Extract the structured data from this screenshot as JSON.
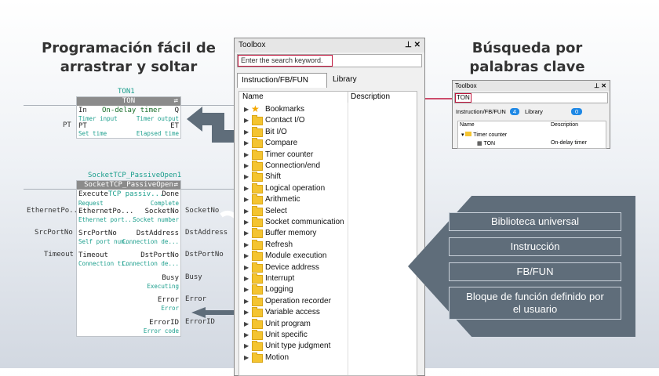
{
  "headings": {
    "drag": "Programación fácil de arrastrar y soltar",
    "search": "Búsqueda por palabras clave"
  },
  "ton_block": {
    "caption": "TON1",
    "title": "TON",
    "desc": "On-delay timer",
    "pins": {
      "in": "In",
      "in_sub": "Timer input",
      "q": "Q",
      "q_sub": "Timer output",
      "pt": "PT",
      "pt_sub": "Set time",
      "et": "ET",
      "et_sub": "Elapsed time"
    },
    "ext_pt": "PT"
  },
  "socket_block": {
    "caption": "SocketTCP_PassiveOpen1",
    "title": "SocketTCP_PassiveOpen",
    "left_pins": [
      {
        "label": "Execute",
        "sub": "Request",
        "extra": "TCP passiv..."
      },
      {
        "label": "EthernetPo...",
        "sub": "Ethernet port..."
      },
      {
        "label": "SrcPortNo",
        "sub": "Self port num..."
      },
      {
        "label": "Timeout",
        "sub": "Connection ti..."
      }
    ],
    "right_pins": [
      {
        "label": "Done",
        "sub": "Complete"
      },
      {
        "label": "SocketNo",
        "sub": "Socket number"
      },
      {
        "label": "DstAddress",
        "sub": "Connection de..."
      },
      {
        "label": "DstPortNo",
        "sub": "Connection de..."
      },
      {
        "label": "Busy",
        "sub": "Executing"
      },
      {
        "label": "Error",
        "sub": "Error"
      },
      {
        "label": "ErrorID",
        "sub": "Error code"
      }
    ],
    "ext_left": [
      "EthernetPo...",
      "SrcPortNo",
      "Timeout"
    ],
    "ext_right": [
      "SocketNo",
      "DstAddress",
      "DstPortNo",
      "Busy",
      "Error",
      "ErrorID"
    ]
  },
  "toolbox": {
    "title": "Toolbox",
    "search_placeholder": "Enter the search keyword.",
    "tabs": [
      "Instruction/FB/FUN",
      "Library"
    ],
    "columns": [
      "Name",
      "Description"
    ],
    "items": [
      "Bookmarks",
      "Contact I/O",
      "Bit I/O",
      "Compare",
      "Timer counter",
      "Connection/end",
      "Shift",
      "Logical operation",
      "Arithmetic",
      "Select",
      "Socket communication",
      "Buffer memory",
      "Refresh",
      "Module execution",
      "Device address",
      "Interrupt",
      "Logging",
      "Operation recorder",
      "Variable access",
      "Unit program",
      "Unit specific",
      "Unit type judgment",
      "Motion"
    ]
  },
  "mini_toolbox": {
    "title": "Toolbox",
    "search_value": "TON",
    "tabs": [
      "Instruction/FB/FUN",
      "Library"
    ],
    "tab_counts": [
      "4",
      "0"
    ],
    "columns": [
      "Name",
      "Description"
    ],
    "folder": "Timer counter",
    "item": "TON",
    "item_desc": "On-delay timer"
  },
  "panel": {
    "items": [
      "Biblioteca universal",
      "Instrucción",
      "FB/FUN",
      "Bloque de función definido por el usuario"
    ]
  },
  "colors": {
    "accent": "#c0143c",
    "panel": "#5f6d7a",
    "caption": "#1a9e8c"
  }
}
